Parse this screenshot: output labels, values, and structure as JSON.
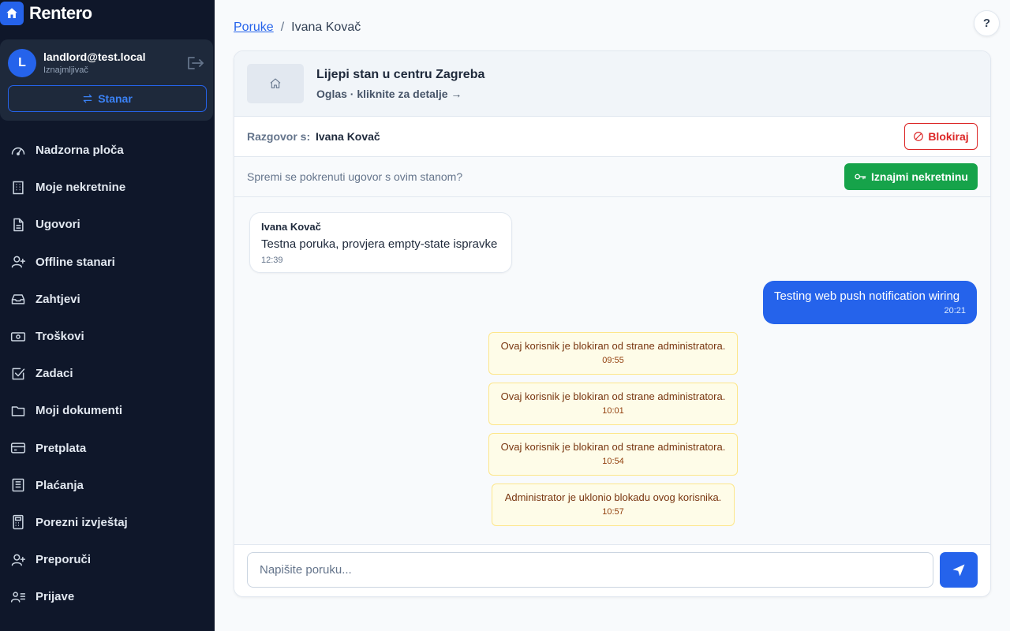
{
  "app": {
    "name": "Rentero"
  },
  "user": {
    "initial": "L",
    "email": "landlord@test.local",
    "role": "Iznajmljivač",
    "switch_label": "Stanar"
  },
  "sidebar": {
    "items": [
      {
        "label": "Nadzorna ploča",
        "icon": "gauge-icon"
      },
      {
        "label": "Moje nekretnine",
        "icon": "building-icon"
      },
      {
        "label": "Ugovori",
        "icon": "document-icon"
      },
      {
        "label": "Offline stanari",
        "icon": "user-plus-icon"
      },
      {
        "label": "Zahtjevi",
        "icon": "inbox-icon"
      },
      {
        "label": "Troškovi",
        "icon": "cash-icon"
      },
      {
        "label": "Zadaci",
        "icon": "checkbox-icon"
      },
      {
        "label": "Moji dokumenti",
        "icon": "folder-icon"
      },
      {
        "label": "Pretplata",
        "icon": "credit-card-icon"
      },
      {
        "label": "Plaćanja",
        "icon": "receipt-icon"
      },
      {
        "label": "Porezni izvještaj",
        "icon": "calculator-icon"
      },
      {
        "label": "Preporuči",
        "icon": "user-plus-icon"
      },
      {
        "label": "Prijave",
        "icon": "id-card-icon"
      }
    ]
  },
  "breadcrumb": {
    "link": "Poruke",
    "separator": "/",
    "current": "Ivana Kovač"
  },
  "help": {
    "label": "?"
  },
  "listing": {
    "title": "Lijepi stan u centru Zagreba",
    "subtitle": "Oglas · kliknite za detalje →"
  },
  "conversation": {
    "label": "Razgovor s:",
    "name": "Ivana Kovač",
    "block_label": "Blokiraj"
  },
  "contract": {
    "prompt": "Spremi se pokrenuti ugovor s ovim stanom?",
    "rent_label": "Iznajmi nekretninu"
  },
  "messages": {
    "incoming": {
      "sender": "Ivana Kovač",
      "text": "Testna poruka, provjera empty-state ispravke",
      "time": "12:39"
    },
    "outgoing": {
      "text": "Testing web push notification wiring",
      "time": "20:21"
    },
    "system": [
      {
        "text": "Ovaj korisnik je blokiran od strane administratora.",
        "time": "09:55"
      },
      {
        "text": "Ovaj korisnik je blokiran od strane administratora.",
        "time": "10:01"
      },
      {
        "text": "Ovaj korisnik je blokiran od strane administratora.",
        "time": "10:54"
      },
      {
        "text": "Administrator je uklonio blokadu ovog korisnika.",
        "time": "10:57"
      }
    ]
  },
  "composer": {
    "placeholder": "Napišite poruku..."
  },
  "colors": {
    "primary": "#2563eb",
    "sidebar_bg": "#0f172a",
    "danger": "#dc2626",
    "success": "#16a34a",
    "notice_bg": "#fefce8"
  }
}
